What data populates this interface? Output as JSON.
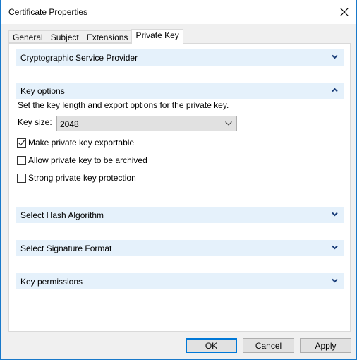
{
  "window": {
    "title": "Certificate Properties",
    "close_icon": "close-icon"
  },
  "tabs": [
    {
      "label": "General",
      "active": false
    },
    {
      "label": "Subject",
      "active": false
    },
    {
      "label": "Extensions",
      "active": false
    },
    {
      "label": "Private Key",
      "active": true
    }
  ],
  "sections": {
    "csp": {
      "label": "Cryptographic Service Provider",
      "expanded": false,
      "icon": "chevron-down-icon"
    },
    "key_options": {
      "label": "Key options",
      "expanded": true,
      "icon": "chevron-up-icon",
      "description": "Set the key length and export options for the private key.",
      "key_size_label": "Key size:",
      "key_size_value": "2048",
      "checkboxes": [
        {
          "label": "Make private key exportable",
          "checked": true
        },
        {
          "label": "Allow private key to be archived",
          "checked": false
        },
        {
          "label": "Strong private key protection",
          "checked": false
        }
      ]
    },
    "hash": {
      "label": "Select Hash Algorithm",
      "expanded": false,
      "icon": "chevron-down-icon"
    },
    "signature": {
      "label": "Select Signature Format",
      "expanded": false,
      "icon": "chevron-down-icon"
    },
    "permissions": {
      "label": "Key permissions",
      "expanded": false,
      "icon": "chevron-down-icon"
    }
  },
  "buttons": {
    "ok": "OK",
    "cancel": "Cancel",
    "apply": "Apply"
  },
  "colors": {
    "accent": "#0078d7",
    "window_border": "#1979ca",
    "section_header_bg": "#e5f1fb",
    "chevron": "#1a3e7a"
  }
}
